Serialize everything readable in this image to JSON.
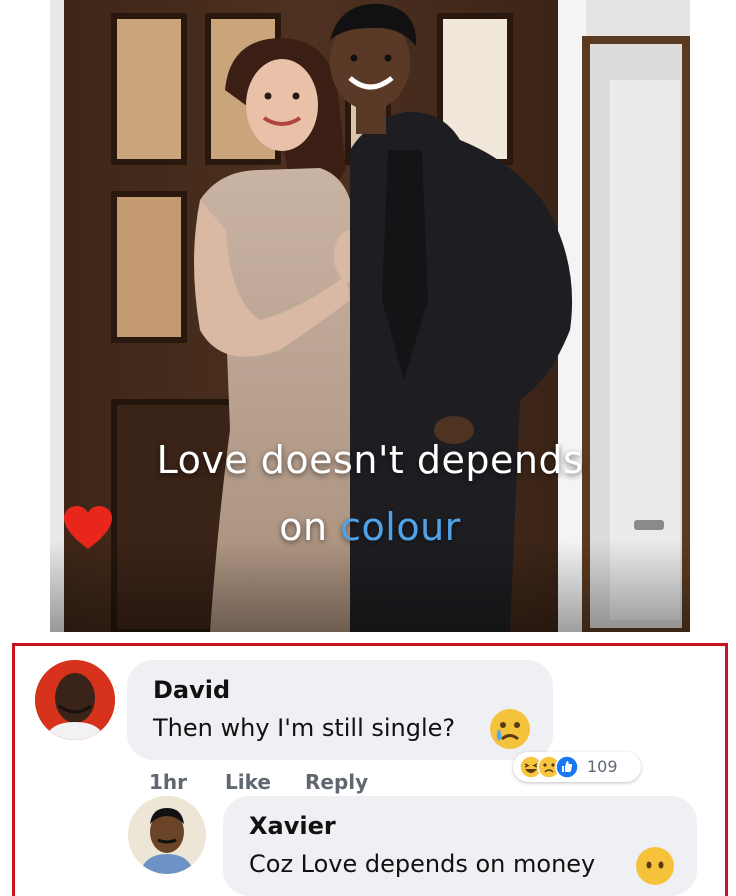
{
  "post": {
    "caption_line1": "Love doesn't depends",
    "caption_line2_prefix": "on",
    "caption_line2_accent": "colour",
    "caption_emoji": "heart-icon",
    "accent_color": "#4fa3e8"
  },
  "comments": [
    {
      "author": "David",
      "text": "Then why I'm still single?",
      "emoji": "crying-face-icon",
      "time": "1hr",
      "like_label": "Like",
      "reply_label": "Reply",
      "reactions": [
        "haha-reaction-icon",
        "sad-reaction-icon",
        "like-reaction-icon"
      ],
      "reaction_count": "109"
    },
    {
      "author": "Xavier",
      "text": "Coz Love depends on money",
      "emoji": "neutral-face-icon"
    }
  ],
  "panel_border_color": "#c8141c"
}
